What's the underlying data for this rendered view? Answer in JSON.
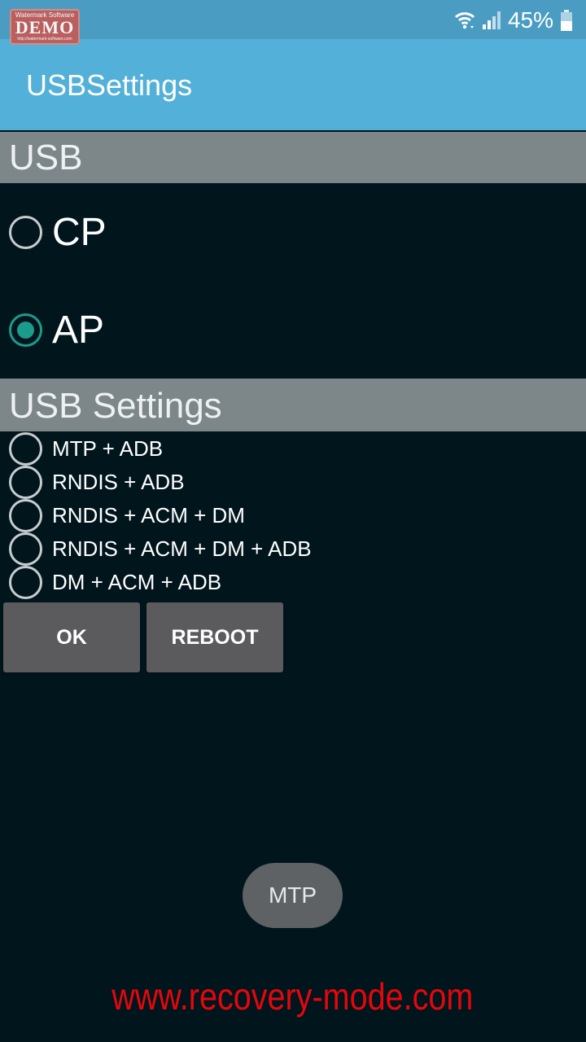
{
  "status_bar": {
    "battery_percent": "45%",
    "icons": [
      "wifi-icon",
      "signal-icon",
      "battery-icon"
    ]
  },
  "watermark_badge": {
    "top": "Watermark Software",
    "main": "DEMO",
    "bottom": "http://watermark-software.com"
  },
  "app_bar": {
    "title": "USBSettings"
  },
  "usb_section": {
    "header": "USB",
    "options": [
      {
        "label": "CP",
        "checked": false
      },
      {
        "label": "AP",
        "checked": true
      }
    ]
  },
  "usb_settings_section": {
    "header": "USB Settings",
    "options": [
      {
        "label": "MTP + ADB",
        "checked": false
      },
      {
        "label": "RNDIS + ADB",
        "checked": false
      },
      {
        "label": "RNDIS + ACM + DM",
        "checked": false
      },
      {
        "label": "RNDIS + ACM + DM + ADB",
        "checked": false
      },
      {
        "label": "DM + ACM + ADB",
        "checked": false
      }
    ]
  },
  "buttons": {
    "ok": "OK",
    "reboot": "REBOOT"
  },
  "toast": {
    "text": "MTP"
  },
  "site_watermark": "www.recovery-mode.com",
  "colors": {
    "status_bar": "#4a9cc3",
    "app_bar": "#53b0d8",
    "background": "#01151d",
    "section_header": "#7d8688",
    "radio_accent": "#1a9b8c",
    "button": "#5b5b5d",
    "watermark_red": "#e5060c"
  }
}
